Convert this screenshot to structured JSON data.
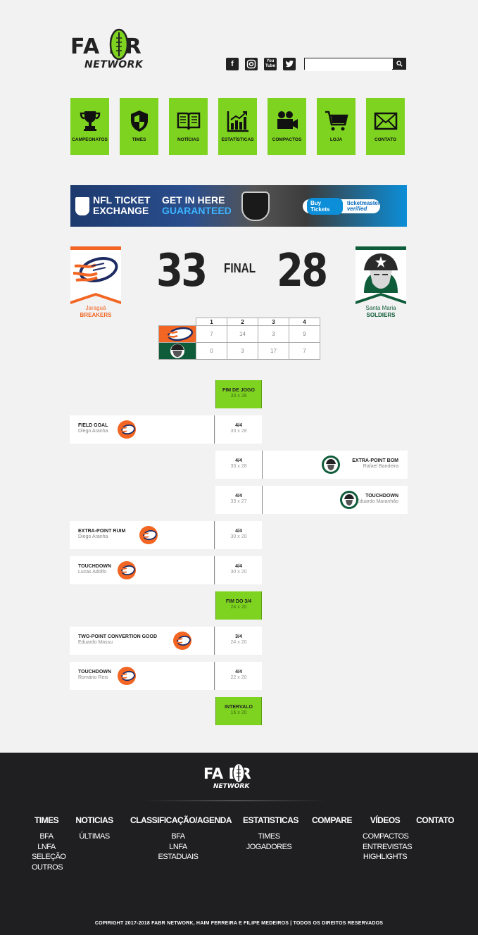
{
  "header": {
    "logo_top": "FA  BR",
    "logo_bottom": "NETWORK",
    "social": [
      "facebook-icon",
      "instagram-icon",
      "youtube-icon",
      "twitter-icon"
    ],
    "search_value": ""
  },
  "nav": [
    {
      "label": "CAMPEONATOS",
      "icon": "trophy-icon"
    },
    {
      "label": "TIMES",
      "icon": "shield-icon"
    },
    {
      "label": "NOTÍCIAS",
      "icon": "book-icon"
    },
    {
      "label": "ESTATÍSTICAS",
      "icon": "chart-icon"
    },
    {
      "label": "COMPACTOS",
      "icon": "camera-icon"
    },
    {
      "label": "LOJA",
      "icon": "cart-icon"
    },
    {
      "label": "CONTATO",
      "icon": "mail-icon"
    }
  ],
  "banner": {
    "nfl_line1": "NFL TICKET",
    "nfl_line2": "EXCHANGE",
    "get_line1": "GET IN HERE",
    "get_line2": "GUARANTEED",
    "buy": "Buy Tickets",
    "tm_line1": "ticketmaster",
    "tm_line2": "verified"
  },
  "game": {
    "home": {
      "city": "Jaraguá",
      "name": "BREAKERS",
      "score": "33",
      "color": "#f26522"
    },
    "away": {
      "city": "Santa Maria",
      "name": "SOLDIERS",
      "score": "28",
      "color": "#0f5c3a"
    },
    "status": "FINAL",
    "quarters": [
      "1",
      "2",
      "3",
      "4"
    ],
    "home_q": [
      "7",
      "14",
      "3",
      "9"
    ],
    "away_q": [
      "0",
      "3",
      "17",
      "7"
    ]
  },
  "timeline": [
    {
      "q": "FIM DE JOGO",
      "score": "33 x 28",
      "highlight": true
    },
    {
      "q": "4/4",
      "score": "33 x 28",
      "side": "left",
      "type": "FIELD GOAL",
      "player": "Diego Aranha"
    },
    {
      "q": "4/4",
      "score": "33 x 28",
      "side": "right",
      "type": "EXTRA-POINT BOM",
      "player": "Rafael Bandeira"
    },
    {
      "q": "4/4",
      "score": "33 x 27",
      "side": "right",
      "type": "TOUCHDOWN",
      "player": "Eduardo Maranhão"
    },
    {
      "q": "4/4",
      "score": "30 x 20",
      "side": "left",
      "type": "EXTRA-POINT RUIM",
      "player": "Diego Aranha"
    },
    {
      "q": "4/4",
      "score": "30 x 20",
      "side": "left",
      "type": "TOUCHDOWN",
      "player": "Lucas Adolfo"
    },
    {
      "q": "FIM DO 3/4",
      "score": "24 x 20",
      "highlight": true
    },
    {
      "q": "3/4",
      "score": "24 x 20",
      "side": "left",
      "type": "TWO-POINT CONVERTION GOOD",
      "player": "Eduardo Massu"
    },
    {
      "q": "4/4",
      "score": "22 x 20",
      "side": "left",
      "type": "TOUCHDOWN",
      "player": "Romário Reis"
    },
    {
      "q": "INTERVALO",
      "score": "16 x 20",
      "highlight": true
    }
  ],
  "footer": {
    "logo_top": "FA  BR",
    "logo_bottom": "NETWORK",
    "columns": [
      {
        "heading": "TIMES",
        "items": [
          "BFA",
          "LNFA",
          "SELEÇÃO",
          "OUTROS"
        ]
      },
      {
        "heading": "NOTICIAS",
        "items": [
          "ÚLTIMAS"
        ]
      },
      {
        "heading": "CLASSIFICAÇÃO/AGENDA",
        "items": [
          "BFA",
          "LNFA",
          "ESTADUAIS"
        ]
      },
      {
        "heading": "ESTATISTICAS",
        "items": [
          "TIMES",
          "JOGADORES"
        ]
      },
      {
        "heading": "COMPARE",
        "items": []
      },
      {
        "heading": "VÍDEOS",
        "items": [
          "COMPACTOS",
          "ENTREVISTAS",
          "HIGHLIGHTS"
        ]
      },
      {
        "heading": "CONTATO",
        "items": []
      }
    ],
    "copyright": "COPIRIGHT 2017-2018 FABR NETWORK, HAIM FERREIRA E FILIPE MEDEIROS  |  TODOS OS DIREITOS RESERVADOS"
  },
  "colors": {
    "accent": "#7ed321",
    "dark": "#1f1f22",
    "home": "#f26522",
    "away": "#0f5c3a"
  }
}
